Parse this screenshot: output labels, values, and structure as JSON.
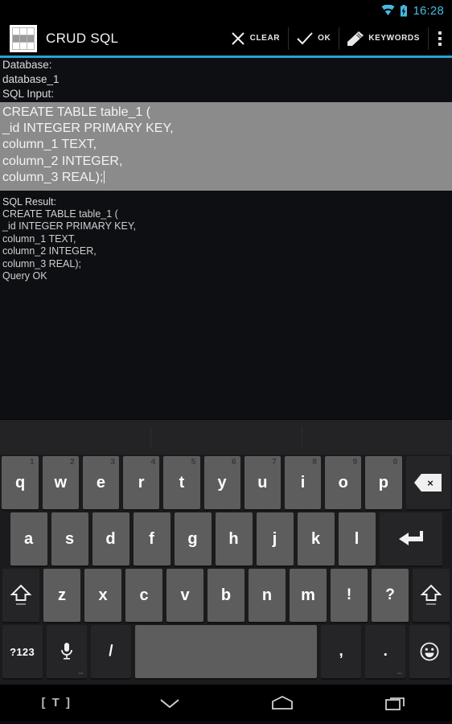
{
  "status_bar": {
    "time": "16:28",
    "wifi_icon": "wifi-icon",
    "battery_icon": "battery-charging-icon",
    "accent_color": "#48b9e0"
  },
  "action_bar": {
    "app_icon": "table-grid-icon",
    "title": "CRUD SQL",
    "actions": [
      {
        "label": "CLEAR",
        "icon": "close-x-icon"
      },
      {
        "label": "OK",
        "icon": "check-icon"
      },
      {
        "label": "KEYWORDS",
        "icon": "pencil-icon"
      }
    ],
    "overflow_icon": "overflow-menu-icon",
    "divider_color": "#2aa3d4"
  },
  "content": {
    "database_label": "Database:",
    "database_value": "database_1",
    "sql_input_label": "SQL Input:",
    "sql_input_lines": [
      "CREATE TABLE table_1 (",
      "_id INTEGER PRIMARY KEY,",
      "column_1 TEXT,",
      "column_2 INTEGER,",
      "column_3 REAL);"
    ],
    "sql_input_background": "#8b8b8b",
    "sql_result_label": "SQL Result:",
    "sql_result_lines": [
      "CREATE TABLE table_1 (",
      "_id INTEGER PRIMARY KEY,",
      "column_1 TEXT,",
      "column_2 INTEGER,",
      "column_3 REAL);",
      "Query OK"
    ]
  },
  "keyboard": {
    "suggestion_slots": [
      "",
      "",
      ""
    ],
    "row1": [
      {
        "key": "q",
        "num": "1"
      },
      {
        "key": "w",
        "num": "2"
      },
      {
        "key": "e",
        "num": "3"
      },
      {
        "key": "r",
        "num": "4"
      },
      {
        "key": "t",
        "num": "5"
      },
      {
        "key": "y",
        "num": "6"
      },
      {
        "key": "u",
        "num": "7"
      },
      {
        "key": "i",
        "num": "8"
      },
      {
        "key": "o",
        "num": "9"
      },
      {
        "key": "p",
        "num": "0"
      }
    ],
    "backspace_icon": "backspace-icon",
    "row2": [
      "a",
      "s",
      "d",
      "f",
      "g",
      "h",
      "j",
      "k",
      "l"
    ],
    "enter_icon": "enter-return-icon",
    "row3": [
      "z",
      "x",
      "c",
      "v",
      "b",
      "n",
      "m",
      "!",
      "?"
    ],
    "shift_icon": "shift-icon",
    "symbols_key": "?123",
    "mic_icon": "microphone-icon",
    "slash_key": "/",
    "space_key": "",
    "comma_key": ",",
    "period_key": ".",
    "emoji_icon": "emoji-smiley-icon"
  },
  "nav_bar": {
    "keyboard_switch_label": "[ T ]",
    "back_icon": "chevron-down-icon",
    "home_icon": "home-icon",
    "recents_icon": "recents-icon"
  }
}
